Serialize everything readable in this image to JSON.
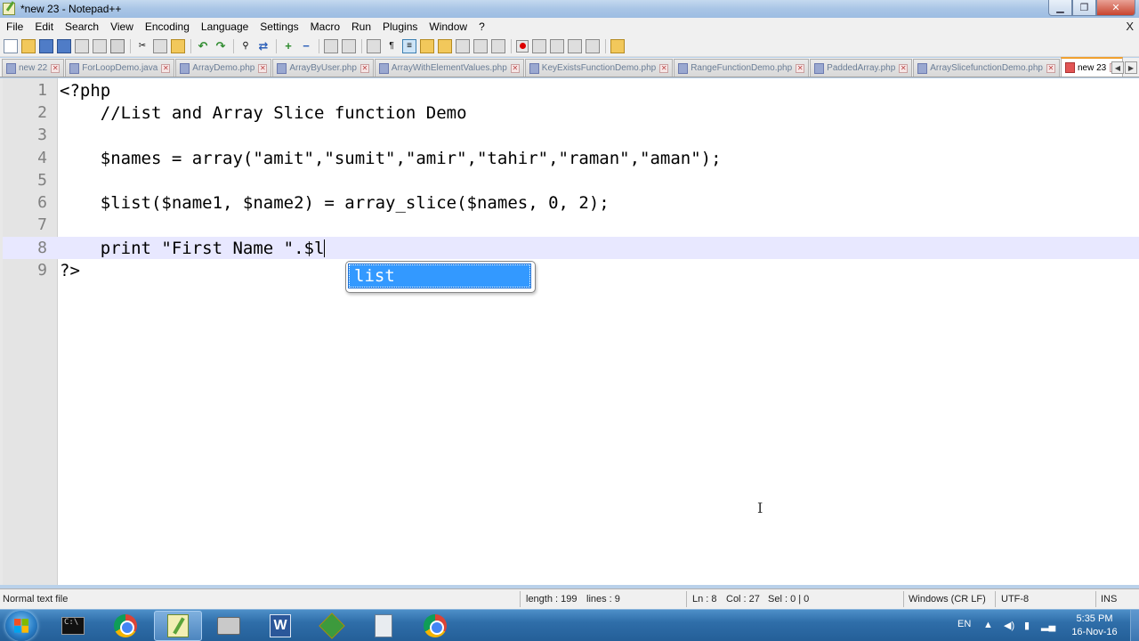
{
  "window": {
    "title": "*new 23 - Notepad++",
    "min": "▁",
    "max": "❐",
    "close": "✕"
  },
  "menu": [
    "File",
    "Edit",
    "Search",
    "View",
    "Encoding",
    "Language",
    "Settings",
    "Macro",
    "Run",
    "Plugins",
    "Window",
    "?"
  ],
  "menu_close": "X",
  "tabs": [
    {
      "label": "new 22"
    },
    {
      "label": "ForLoopDemo.java"
    },
    {
      "label": "ArrayDemo.php"
    },
    {
      "label": "ArrayByUser.php"
    },
    {
      "label": "ArrayWithElementValues.php"
    },
    {
      "label": "KeyExistsFunctionDemo.php"
    },
    {
      "label": "RangeFunctionDemo.php"
    },
    {
      "label": "PaddedArray.php"
    },
    {
      "label": "ArraySlicefunctionDemo.php"
    },
    {
      "label": "new 23",
      "active": true
    }
  ],
  "editor": {
    "lines": [
      {
        "num": "1",
        "text": "<?php"
      },
      {
        "num": "2",
        "text": "    //List and Array Slice function Demo"
      },
      {
        "num": "3",
        "text": ""
      },
      {
        "num": "4",
        "text": "    $names = array(\"amit\",\"sumit\",\"amir\",\"tahir\",\"raman\",\"aman\");"
      },
      {
        "num": "5",
        "text": ""
      },
      {
        "num": "6",
        "text": "    $list($name1, $name2) = array_slice($names, 0, 2);"
      },
      {
        "num": "7",
        "text": ""
      },
      {
        "num": "8",
        "text": "    print \"First Name \".$l"
      },
      {
        "num": "9",
        "text": "?>"
      }
    ],
    "current_line": 8,
    "autocomplete": {
      "items": [
        "list"
      ],
      "selected": "list"
    }
  },
  "status": {
    "file_type": "Normal text file",
    "length": "length : 199",
    "lines": "lines : 9",
    "ln": "Ln : 8",
    "col": "Col : 27",
    "sel": "Sel : 0 | 0",
    "eol": "Windows (CR LF)",
    "encoding": "UTF-8",
    "mode": "INS"
  },
  "taskbar": {
    "apps": [
      "cmd",
      "chrome",
      "notepad++",
      "printer",
      "word",
      "app",
      "calculator",
      "chrome"
    ],
    "active_app": "notepad++",
    "lang": "EN",
    "time": "5:35 PM",
    "date": "16-Nov-16"
  }
}
